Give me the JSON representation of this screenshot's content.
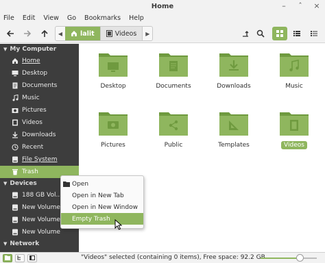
{
  "window": {
    "title": "Home"
  },
  "menubar": [
    "File",
    "Edit",
    "View",
    "Go",
    "Bookmarks",
    "Help"
  ],
  "toolbar": {
    "breadcrumbs": [
      {
        "label": "lalit",
        "icon": "home-icon"
      },
      {
        "label": "Videos",
        "icon": "film-icon"
      }
    ]
  },
  "sidebar": {
    "sections": {
      "my_computer": "My Computer",
      "devices": "Devices",
      "network": "Network"
    },
    "items": [
      {
        "label": "Home",
        "icon": "home-icon"
      },
      {
        "label": "Desktop",
        "icon": "desktop-icon"
      },
      {
        "label": "Documents",
        "icon": "documents-icon"
      },
      {
        "label": "Music",
        "icon": "music-icon"
      },
      {
        "label": "Pictures",
        "icon": "pictures-icon"
      },
      {
        "label": "Videos",
        "icon": "videos-icon"
      },
      {
        "label": "Downloads",
        "icon": "downloads-icon"
      },
      {
        "label": "Recent",
        "icon": "recent-icon"
      },
      {
        "label": "File System",
        "icon": "drive-icon"
      },
      {
        "label": "Trash",
        "icon": "trash-icon"
      }
    ],
    "devices": [
      {
        "label": "188 GB Vol...",
        "icon": "drive-icon"
      },
      {
        "label": "New Volume",
        "icon": "drive-icon"
      },
      {
        "label": "New Volume",
        "icon": "drive-icon"
      },
      {
        "label": "New Volume",
        "icon": "drive-icon"
      }
    ]
  },
  "files": [
    {
      "label": "Desktop",
      "icon": "desktop-folder-icon"
    },
    {
      "label": "Documents",
      "icon": "documents-folder-icon"
    },
    {
      "label": "Downloads",
      "icon": "downloads-folder-icon"
    },
    {
      "label": "Music",
      "icon": "music-folder-icon"
    },
    {
      "label": "Pictures",
      "icon": "pictures-folder-icon"
    },
    {
      "label": "Public",
      "icon": "public-folder-icon"
    },
    {
      "label": "Templates",
      "icon": "templates-folder-icon"
    },
    {
      "label": "Videos",
      "icon": "videos-folder-icon"
    }
  ],
  "context_menu": {
    "items": [
      "Open",
      "Open in New Tab",
      "Open in New Window",
      "Empty Trash"
    ],
    "highlighted": "Empty Trash"
  },
  "statusbar": {
    "text": "\"Videos\" selected (containing 0 items), Free space: 92.2 GB"
  },
  "colors": {
    "accent": "#8fb65e",
    "sidebar_bg": "#3d3d3d",
    "folder": "#8fb65e",
    "folder_dark": "#6f9a3f"
  }
}
